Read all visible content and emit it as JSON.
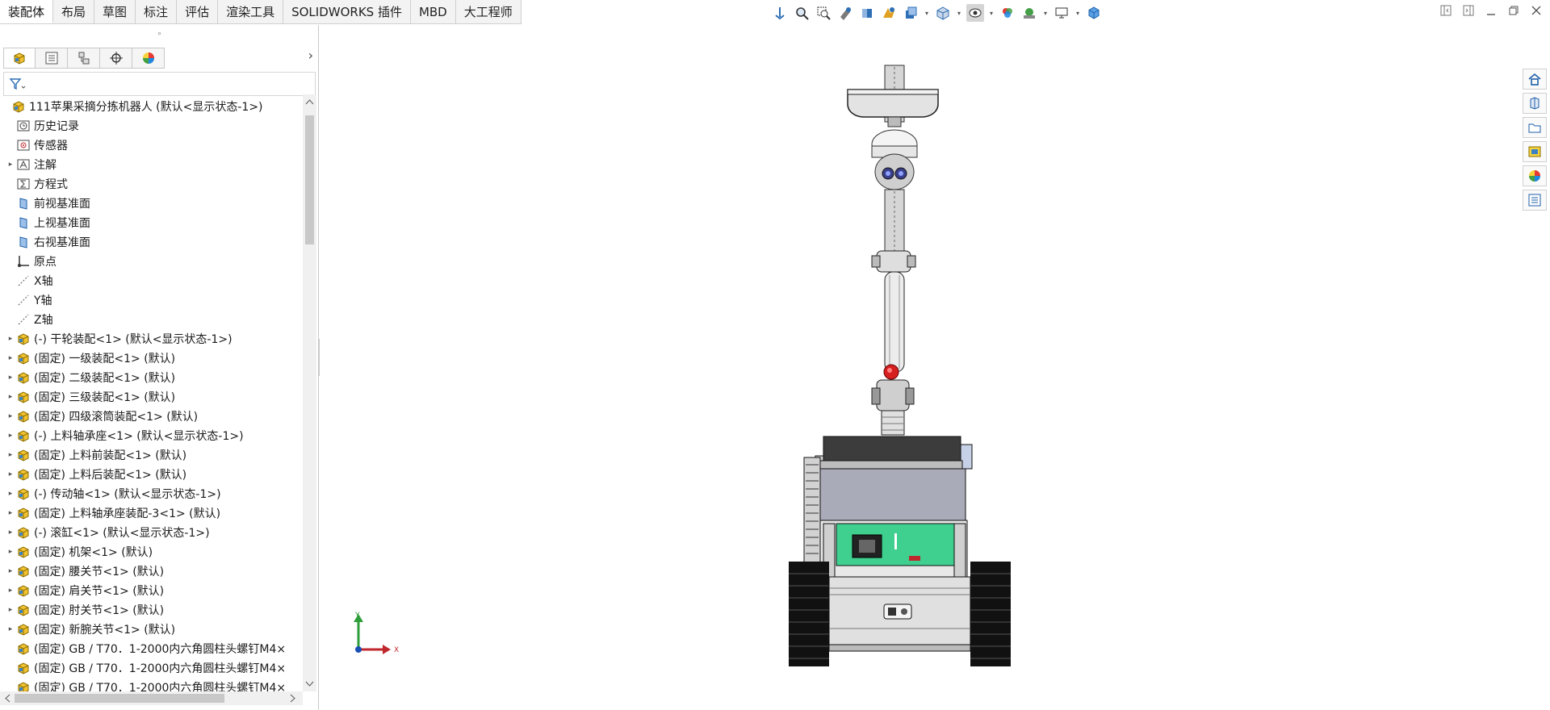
{
  "tabs": [
    "装配体",
    "布局",
    "草图",
    "标注",
    "评估",
    "渲染工具",
    "SOLIDWORKS 插件",
    "MBD",
    "大工程师"
  ],
  "active_tab": 0,
  "toolbar": {
    "icons": [
      "view-orientation-icon",
      "zoom-to-fit-icon",
      "zoom-area-icon",
      "previous-view-icon",
      "section-view-icon",
      "dynamic-annotation-icon",
      "view-orientation-dropdown-icon",
      "display-style-icon",
      "hide-show-items-icon",
      "edit-appearance-icon",
      "apply-scene-icon",
      "view-settings-icon",
      "3d-view-cube-icon"
    ]
  },
  "feature_tree": {
    "root": "111苹果采摘分拣机器人 (默认<显示状态-1>)",
    "items": [
      {
        "label": "历史记录",
        "icon": "history-icon",
        "expand": false
      },
      {
        "label": "传感器",
        "icon": "sensor-icon",
        "expand": false
      },
      {
        "label": "注解",
        "icon": "annotation-icon",
        "expand": true
      },
      {
        "label": "方程式",
        "icon": "equation-icon",
        "expand": false
      },
      {
        "label": "前视基准面",
        "icon": "plane-icon",
        "expand": false
      },
      {
        "label": "上视基准面",
        "icon": "plane-icon",
        "expand": false
      },
      {
        "label": "右视基准面",
        "icon": "plane-icon",
        "expand": false
      },
      {
        "label": "原点",
        "icon": "origin-icon",
        "expand": false
      },
      {
        "label": "X轴",
        "icon": "axis-icon",
        "expand": false
      },
      {
        "label": "Y轴",
        "icon": "axis-icon",
        "expand": false
      },
      {
        "label": "Z轴",
        "icon": "axis-icon",
        "expand": false
      },
      {
        "label": "(-) 干轮装配<1> (默认<显示状态-1>)",
        "icon": "subassembly-icon",
        "expand": true
      },
      {
        "label": "(固定) 一级装配<1> (默认)",
        "icon": "subassembly-icon",
        "expand": true
      },
      {
        "label": "(固定) 二级装配<1> (默认)",
        "icon": "subassembly-icon",
        "expand": true
      },
      {
        "label": "(固定) 三级装配<1> (默认)",
        "icon": "subassembly-icon",
        "expand": true
      },
      {
        "label": "(固定) 四级滚筒装配<1> (默认)",
        "icon": "subassembly-icon",
        "expand": true
      },
      {
        "label": "(-) 上料轴承座<1> (默认<显示状态-1>)",
        "icon": "subassembly-icon",
        "expand": true
      },
      {
        "label": "(固定) 上料前装配<1> (默认)",
        "icon": "subassembly-icon",
        "expand": true
      },
      {
        "label": "(固定) 上料后装配<1> (默认)",
        "icon": "subassembly-icon",
        "expand": true
      },
      {
        "label": "(-) 传动轴<1> (默认<显示状态-1>)",
        "icon": "subassembly-icon",
        "expand": true
      },
      {
        "label": "(固定) 上料轴承座装配-3<1> (默认)",
        "icon": "subassembly-icon",
        "expand": true
      },
      {
        "label": "(-) 滚缸<1> (默认<显示状态-1>)",
        "icon": "subassembly-icon",
        "expand": true
      },
      {
        "label": "(固定) 机架<1> (默认)",
        "icon": "subassembly-icon",
        "expand": true
      },
      {
        "label": "(固定) 腰关节<1> (默认)",
        "icon": "subassembly-icon",
        "expand": true
      },
      {
        "label": "(固定) 肩关节<1> (默认)",
        "icon": "subassembly-icon",
        "expand": true
      },
      {
        "label": "(固定) 肘关节<1> (默认)",
        "icon": "subassembly-icon",
        "expand": true
      },
      {
        "label": "(固定) 新腕关节<1> (默认)",
        "icon": "subassembly-icon",
        "expand": true
      },
      {
        "label": "(固定) GB / T70．1-2000内六角圆柱头螺钉M4×",
        "icon": "subassembly-icon",
        "expand": false
      },
      {
        "label": "(固定) GB / T70．1-2000内六角圆柱头螺钉M4×",
        "icon": "subassembly-icon",
        "expand": false
      },
      {
        "label": "(固定) GB / T70．1-2000内六角圆柱头螺钉M4×",
        "icon": "subassembly-icon",
        "expand": false
      }
    ]
  },
  "triad": {
    "x": "X",
    "y": "Y"
  },
  "colors": {
    "x_axis": "#c0272d",
    "y_axis": "#2e9e3a",
    "z_axis": "#1a4fb3",
    "model_gray": "#a9abb8",
    "pcb_green": "#3fcf8e"
  }
}
